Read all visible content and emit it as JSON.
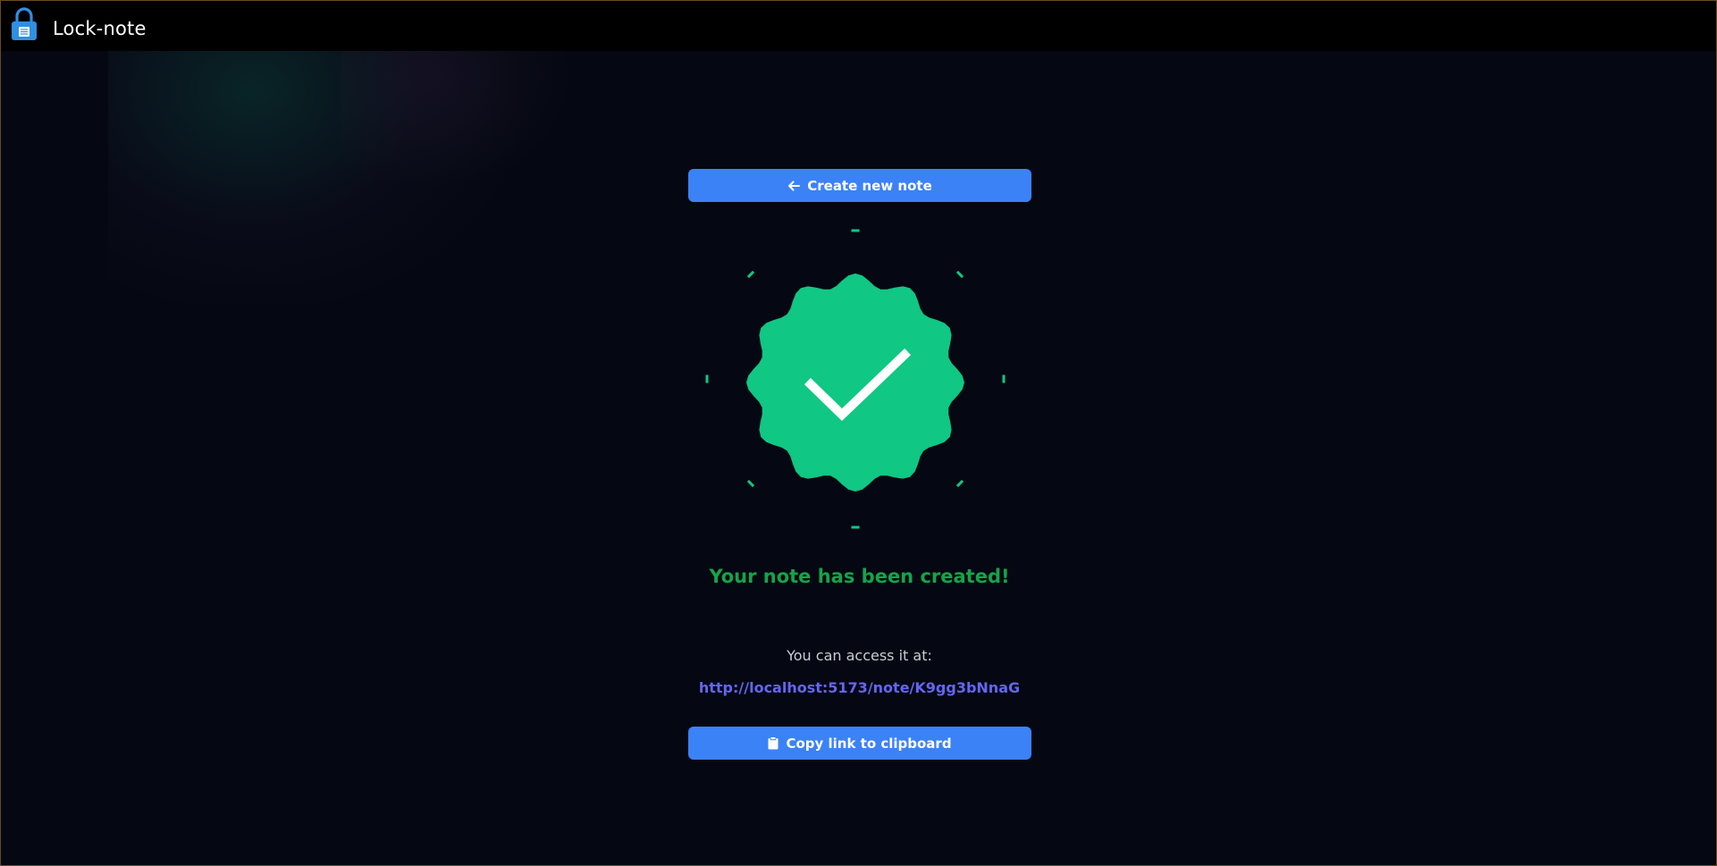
{
  "app": {
    "title": "Lock-note",
    "logo_icon": "padlock-icon"
  },
  "actions": {
    "create_new_note": {
      "label": "Create new note",
      "icon": "arrow-left-icon"
    },
    "copy_link": {
      "label": "Copy link to clipboard",
      "icon": "clipboard-icon"
    }
  },
  "success": {
    "badge_icon": "verified-badge-check-icon",
    "message": "Your note has been created!",
    "access_label": "You can access it at:",
    "note_url": "http://localhost:5173/note/K9gg3bNnaG"
  },
  "colors": {
    "background": "#050812",
    "topbar": "#000000",
    "button": "#3b82f6",
    "badge": "#10c784",
    "success_text": "#16a34a",
    "link": "#6366f1"
  }
}
